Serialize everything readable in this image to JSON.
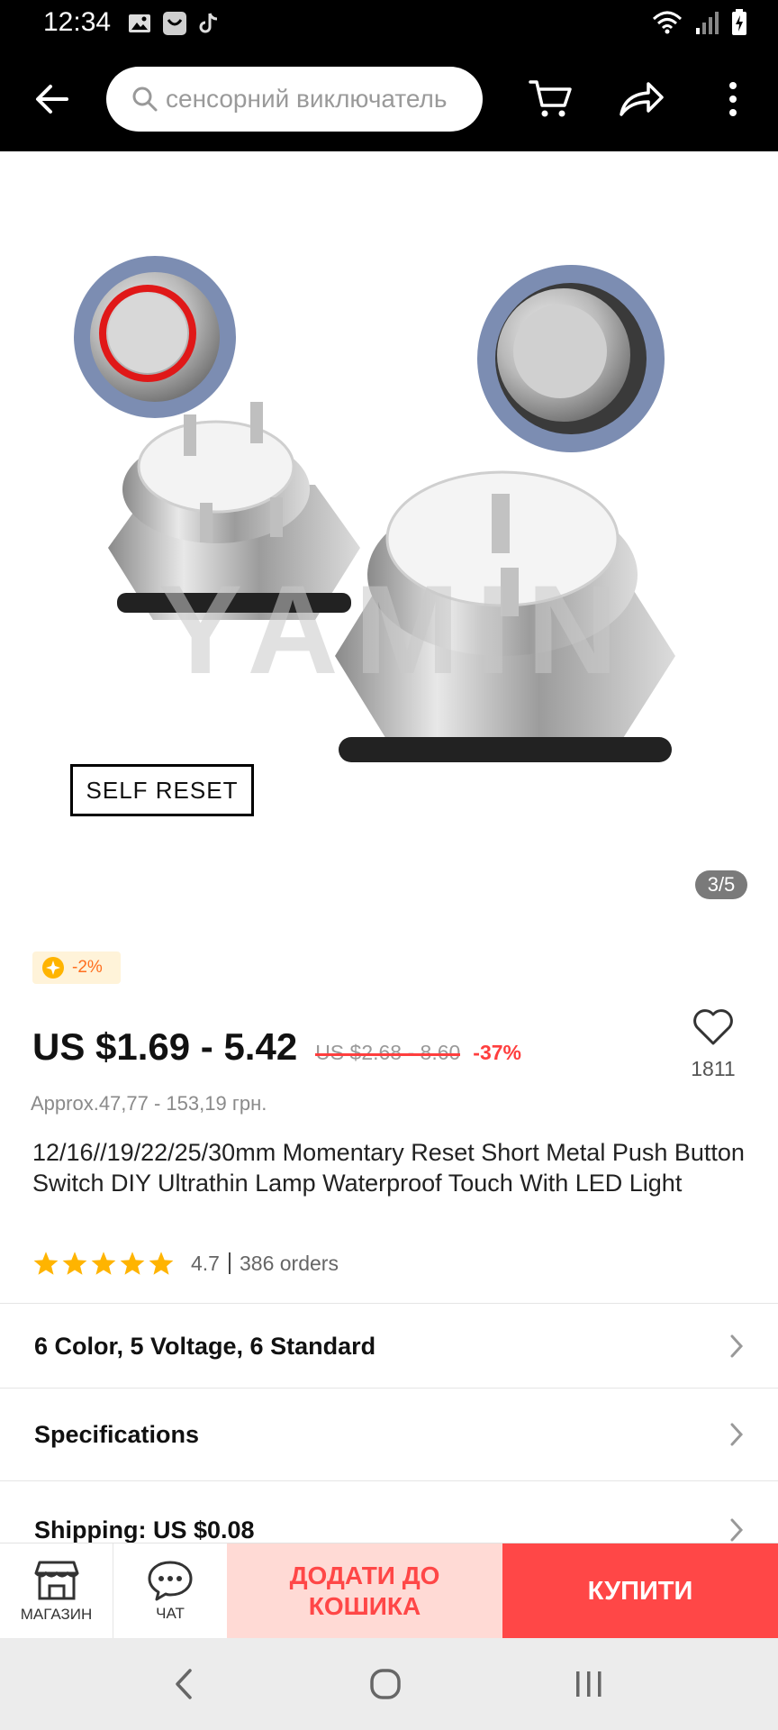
{
  "status_bar": {
    "time": "12:34",
    "left_icons": [
      "gallery-icon",
      "app-icon",
      "tiktok-icon"
    ],
    "right_icons": [
      "wifi-icon",
      "signal-icon",
      "battery-icon"
    ]
  },
  "header": {
    "search_placeholder": "сенсорний виключатель",
    "icons": [
      "back-arrow-icon",
      "search-icon",
      "cart-icon",
      "share-icon",
      "more-vertical-icon"
    ]
  },
  "gallery": {
    "watermark": "YAMIN",
    "image_caption": "SELF RESET",
    "counter": "3/5"
  },
  "coin_badge": {
    "text": "-2%"
  },
  "price": {
    "current": "US $1.69 - 5.42",
    "original": "US $2.68 - 8.60",
    "discount": "-37%",
    "approx": "Approx.47,77 - 153,19 грн."
  },
  "wishlist": {
    "count": "1811"
  },
  "product": {
    "title": "12/16//19/22/25/30mm Momentary Reset Short Metal Push Button Switch DIY Ultrathin Lamp Waterproof Touch With LED Light",
    "rating": "4.7",
    "orders": "386 orders",
    "stars": 5
  },
  "rows": {
    "variants": "6 Color, 5 Voltage, 6 Standard",
    "specifications": "Specifications",
    "shipping": "Shipping: US $0.08"
  },
  "action_bar": {
    "store_label": "МАГАЗИН",
    "chat_label": "ЧАТ",
    "add_to_cart": "ДОДАТИ ДО КОШИКА",
    "buy": "КУПИТИ"
  },
  "colors": {
    "accent": "#ff4747",
    "cart_bg": "#ffdad5",
    "coin_badge_bg": "#fff3d9",
    "star": "#ffb400"
  }
}
